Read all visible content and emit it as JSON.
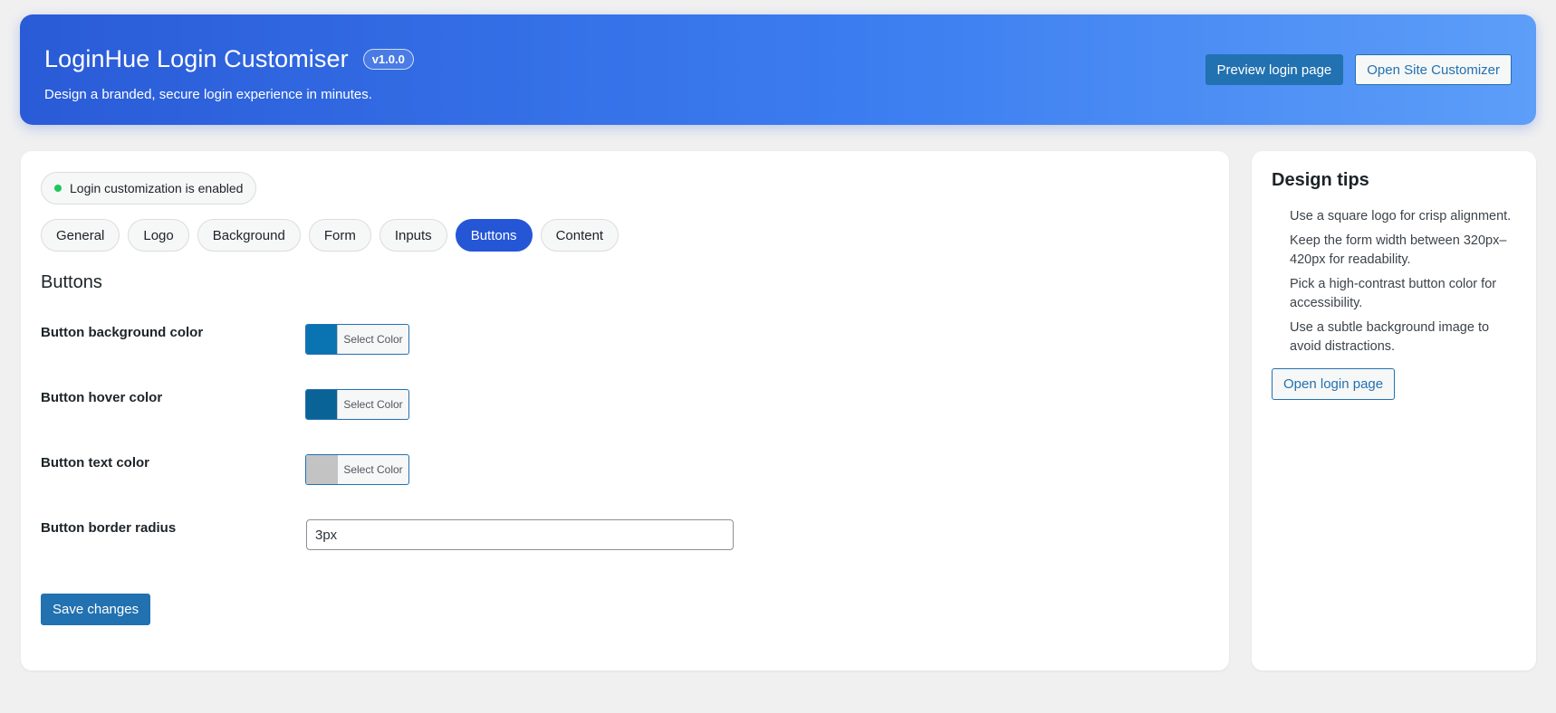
{
  "header": {
    "title": "LoginHue Login Customiser",
    "version": "v1.0.0",
    "subtitle": "Design a branded, secure login experience in minutes.",
    "preview_label": "Preview login page",
    "customizer_label": "Open Site Customizer"
  },
  "status": {
    "text": "Login customization is enabled",
    "color": "#22c55e"
  },
  "tabs": [
    {
      "label": "General"
    },
    {
      "label": "Logo"
    },
    {
      "label": "Background"
    },
    {
      "label": "Form"
    },
    {
      "label": "Inputs"
    },
    {
      "label": "Buttons",
      "active": true
    },
    {
      "label": "Content"
    }
  ],
  "section": {
    "title": "Buttons",
    "fields": [
      {
        "label": "Button background color",
        "type": "color",
        "color": "#0a73b1",
        "button_text": "Select Color"
      },
      {
        "label": "Button hover color",
        "type": "color",
        "color": "#0a6396",
        "button_text": "Select Color"
      },
      {
        "label": "Button text color",
        "type": "color",
        "color": "#c3c3c3",
        "button_text": "Select Color"
      },
      {
        "label": "Button border radius",
        "type": "text",
        "value": "3px"
      }
    ],
    "save_label": "Save changes"
  },
  "sidebar": {
    "title": "Design tips",
    "tips": [
      "Use a square logo for crisp alignment.",
      "Keep the form width between 320px–420px for readability.",
      "Pick a high-contrast button color for accessibility.",
      "Use a subtle background image to avoid distractions."
    ],
    "button_label": "Open login page"
  },
  "colors": {
    "header_gradient_start": "#2a5bd7",
    "header_gradient_end": "#5c9ef8",
    "active_tab": "#2556d6",
    "primary_button": "#2271b1"
  }
}
